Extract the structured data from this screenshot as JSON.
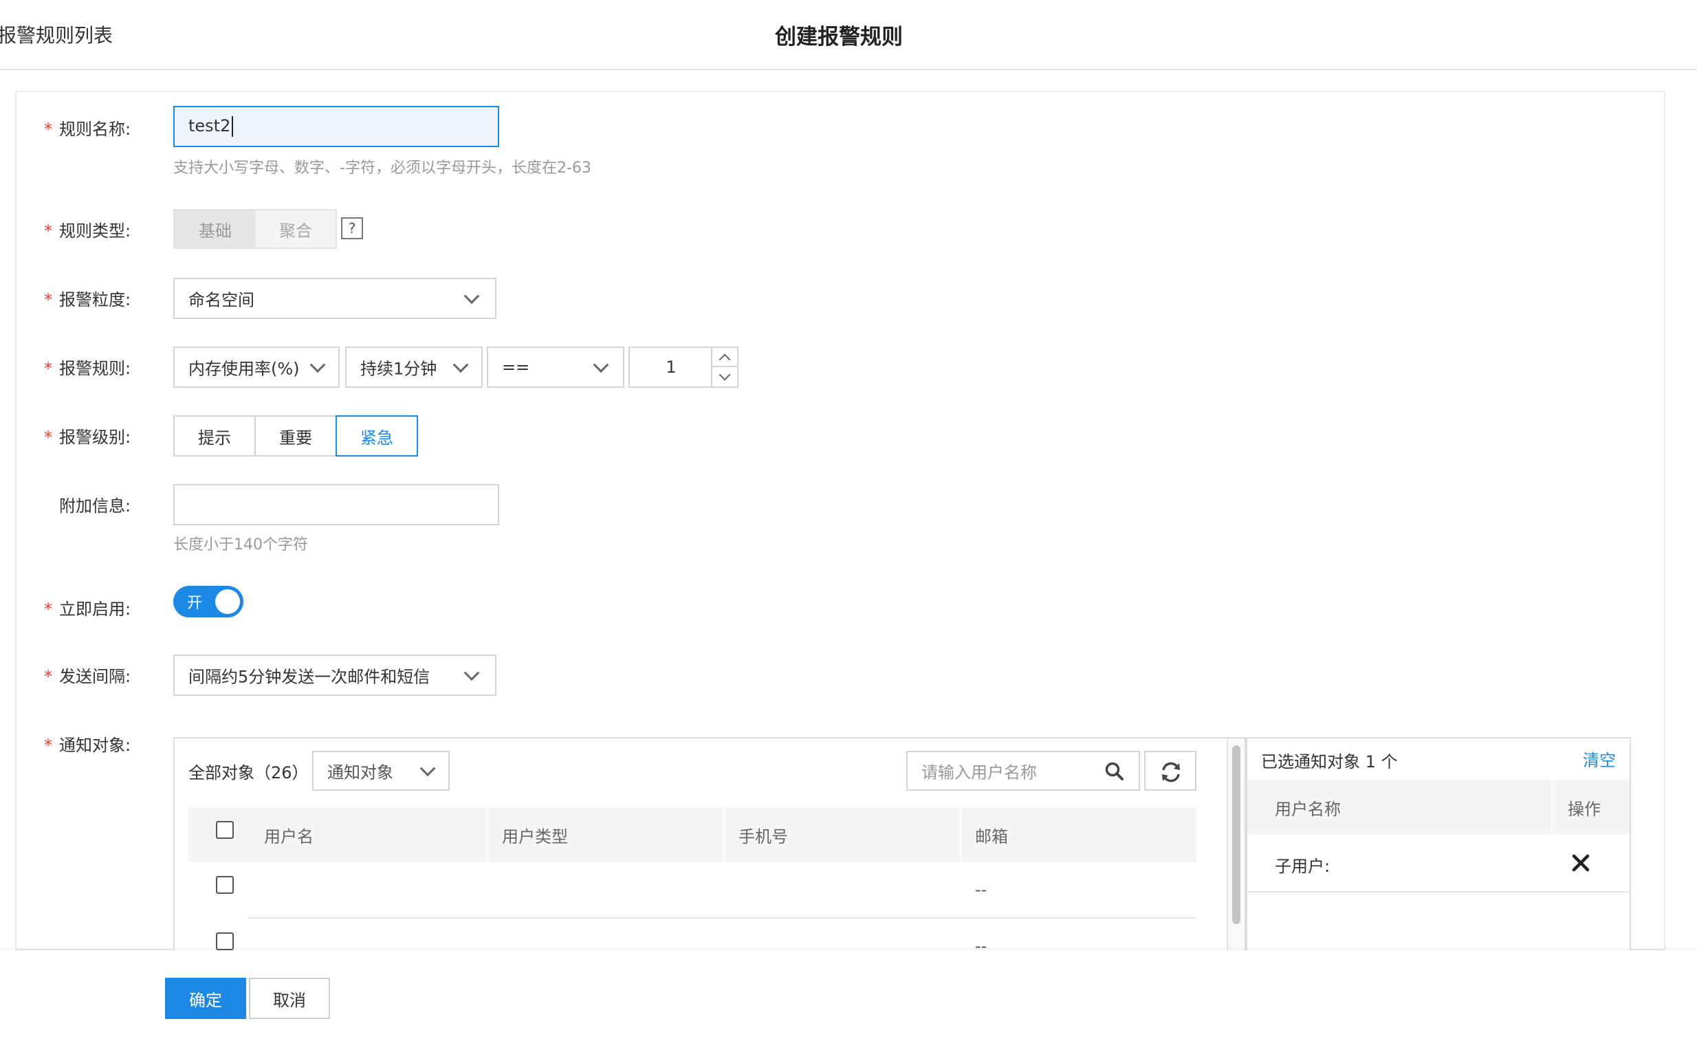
{
  "header": {
    "back_label": "报警规则列表",
    "title": "创建报警规则"
  },
  "form": {
    "rule_name": {
      "label": "规则名称:",
      "value": "test2",
      "hint": "支持大小写字母、数字、-字符，必须以字母开头，长度在2-63"
    },
    "rule_type": {
      "label": "规则类型:",
      "options": [
        "基础",
        "聚合"
      ],
      "help": "?"
    },
    "granularity": {
      "label": "报警粒度:",
      "value": "命名空间"
    },
    "alarm_rule": {
      "label": "报警规则:",
      "metric": "内存使用率(%)",
      "duration": "持续1分钟",
      "operator": "==",
      "threshold": "1"
    },
    "level": {
      "label": "报警级别:",
      "options": [
        "提示",
        "重要",
        "紧急"
      ],
      "selected": "紧急"
    },
    "extra_info": {
      "label": "附加信息:",
      "value": "",
      "hint": "长度小于140个字符"
    },
    "enable_now": {
      "label": "立即启用:",
      "toggle_label": "开",
      "on": true
    },
    "send_interval": {
      "label": "发送间隔:",
      "value": "间隔约5分钟发送一次邮件和短信"
    },
    "notify_target": {
      "label": "通知对象:"
    }
  },
  "notify_panel": {
    "all_count_label": "全部对象（26）",
    "filter_select": "通知对象",
    "search_placeholder": "请输入用户名称",
    "columns": [
      "用户名",
      "用户类型",
      "手机号",
      "邮箱"
    ],
    "rows": [
      {
        "username": "",
        "type": "",
        "phone": "",
        "email": "--"
      },
      {
        "username": "",
        "type": "",
        "phone": "",
        "email": "--"
      }
    ]
  },
  "selected_panel": {
    "title": "已选通知对象 1 个",
    "clear_label": "清空",
    "columns": [
      "用户名称",
      "操作"
    ],
    "rows": [
      {
        "name": "子用户:"
      }
    ]
  },
  "footer": {
    "confirm_label": "确定",
    "cancel_label": "取消"
  },
  "colors": {
    "accent": "#1e88e5",
    "required": "#e8403a"
  }
}
